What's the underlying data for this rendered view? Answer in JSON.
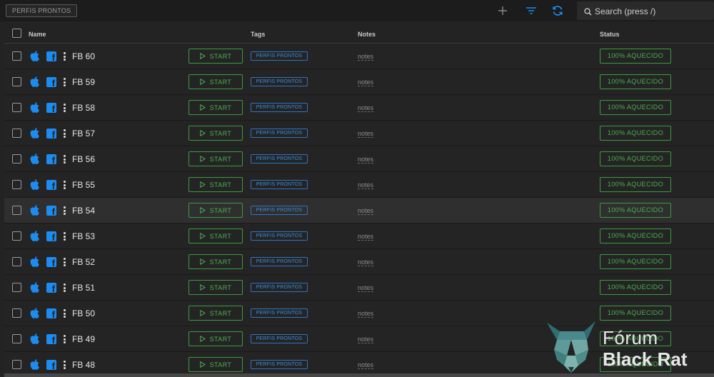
{
  "toolbar": {
    "tag_filter_label": "PERFIS PRONTOS",
    "icons": [
      "plus-icon",
      "filter-icon",
      "refresh-icon",
      "search-icon"
    ],
    "search_placeholder": "Search (press /)"
  },
  "table": {
    "columns": {
      "name": "Name",
      "tags": "Tags",
      "notes": "Notes",
      "status": "Status"
    },
    "rows": [
      {
        "name": "FB 60",
        "start": "START",
        "tag": "PERFIS PRONTOS",
        "notes": "notes",
        "status": "100% AQUECIDO"
      },
      {
        "name": "FB 59",
        "start": "START",
        "tag": "PERFIS PRONTOS",
        "notes": "notes",
        "status": "100% AQUECIDO"
      },
      {
        "name": "FB 58",
        "start": "START",
        "tag": "PERFIS PRONTOS",
        "notes": "notes",
        "status": "100% AQUECIDO"
      },
      {
        "name": "FB 57",
        "start": "START",
        "tag": "PERFIS PRONTOS",
        "notes": "notes",
        "status": "100% AQUECIDO"
      },
      {
        "name": "FB 56",
        "start": "START",
        "tag": "PERFIS PRONTOS",
        "notes": "notes",
        "status": "100% AQUECIDO"
      },
      {
        "name": "FB 55",
        "start": "START",
        "tag": "PERFIS PRONTOS",
        "notes": "notes",
        "status": "100% AQUECIDO"
      },
      {
        "name": "FB 54",
        "start": "START",
        "tag": "PERFIS PRONTOS",
        "notes": "notes",
        "status": "100% AQUECIDO"
      },
      {
        "name": "FB 53",
        "start": "START",
        "tag": "PERFIS PRONTOS",
        "notes": "notes",
        "status": "100% AQUECIDO"
      },
      {
        "name": "FB 52",
        "start": "START",
        "tag": "PERFIS PRONTOS",
        "notes": "notes",
        "status": "100% AQUECIDO"
      },
      {
        "name": "FB 51",
        "start": "START",
        "tag": "PERFIS PRONTOS",
        "notes": "notes",
        "status": "100% AQUECIDO"
      },
      {
        "name": "FB 50",
        "start": "START",
        "tag": "PERFIS PRONTOS",
        "notes": "notes",
        "status": "100% AQUECIDO"
      },
      {
        "name": "FB 49",
        "start": "START",
        "tag": "PERFIS PRONTOS",
        "notes": "notes",
        "status": "100% AQUECIDO"
      },
      {
        "name": "FB 48",
        "start": "START",
        "tag": "PERFIS PRONTOS",
        "notes": "notes",
        "status": "100% AQUECIDO"
      }
    ],
    "row_icons": [
      "apple-icon",
      "facebook-icon",
      "more-vertical-icon"
    ]
  },
  "watermark": {
    "line1": "Fórum",
    "line2": "Black Rat"
  },
  "colors": {
    "background": "#232323",
    "accent_blue": "#1d8cf0",
    "status_green": "#4caf50",
    "tag_blue": "#2f74c0"
  }
}
